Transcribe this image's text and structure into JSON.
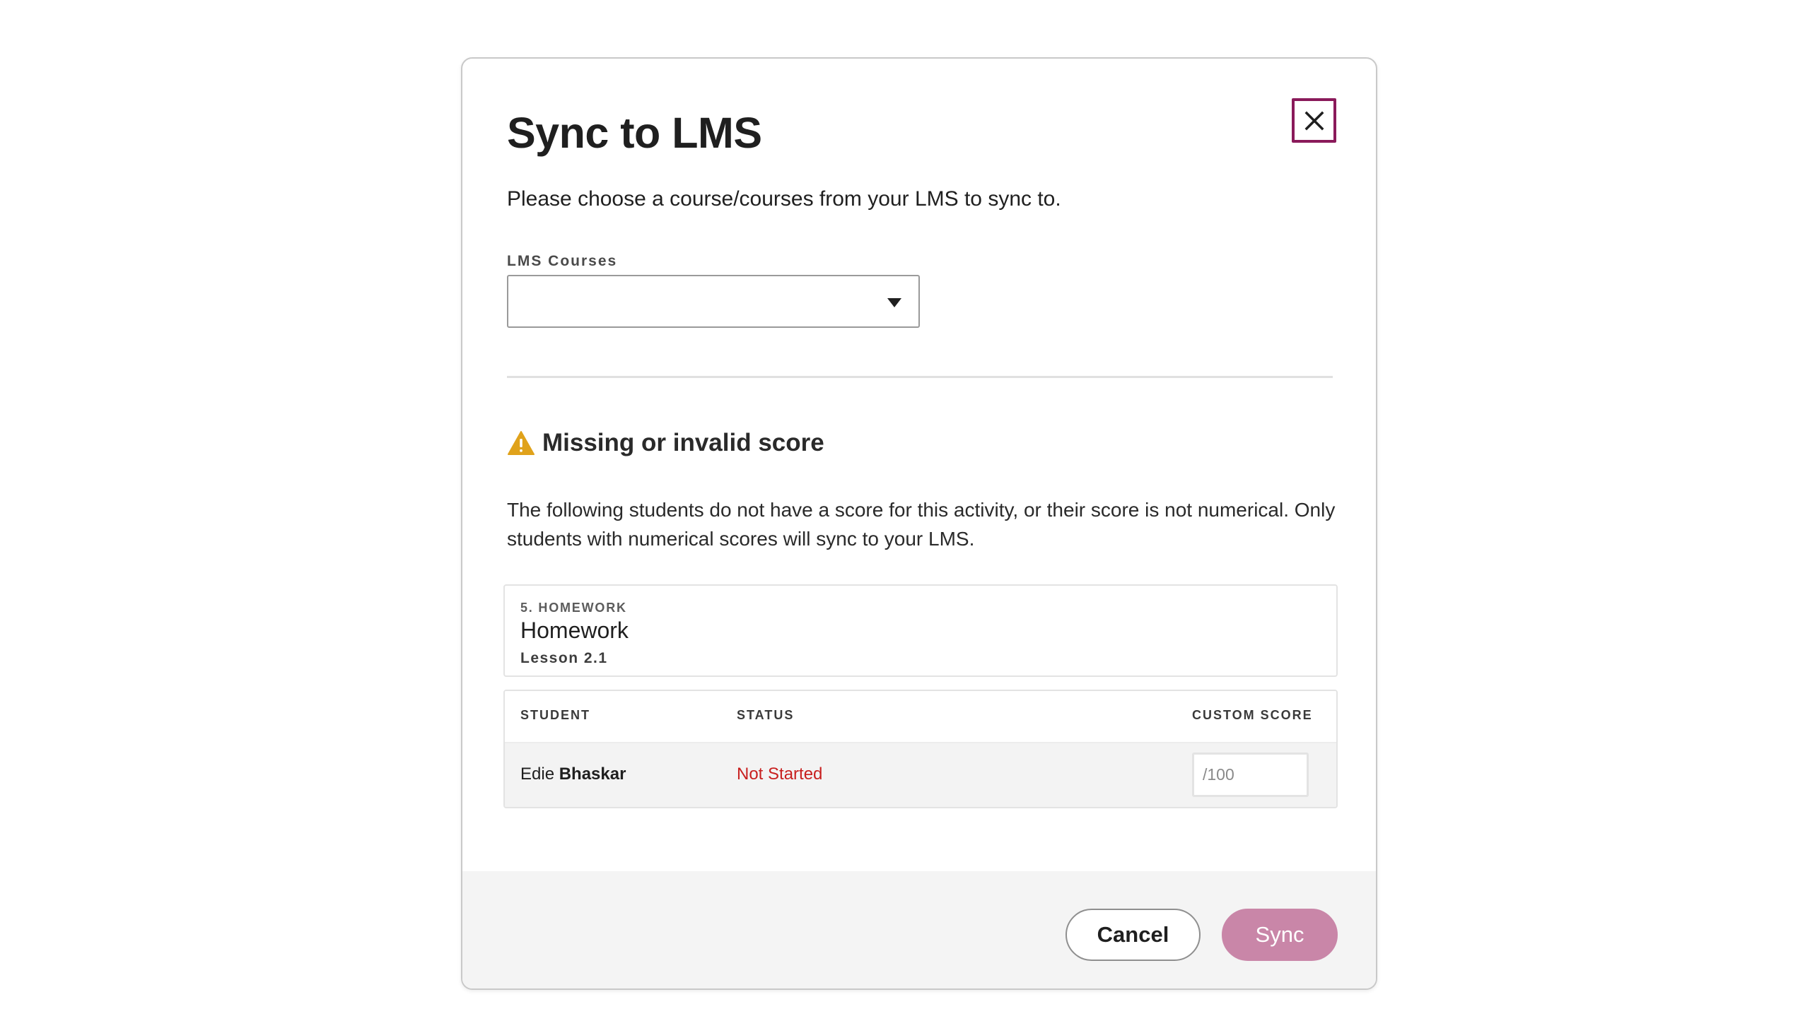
{
  "dialog": {
    "title": "Sync to LMS",
    "subtitle": "Please choose a course/courses from your LMS to sync to.",
    "close_icon": "close-icon"
  },
  "courses_field": {
    "label": "LMS Courses",
    "selected_value": ""
  },
  "warning": {
    "icon": "warning-triangle-icon",
    "icon_color": "#e0a21b",
    "title": "Missing or invalid score",
    "description": "The following students do not have a score for this activity, or their score is not numerical. Only students with numerical scores will sync to your LMS."
  },
  "activity": {
    "kicker": "5. HOMEWORK",
    "name": "Homework",
    "lesson": "Lesson 2.1"
  },
  "table": {
    "columns": [
      "STUDENT",
      "STATUS",
      "CUSTOM SCORE"
    ],
    "rows": [
      {
        "student_first": "Edie",
        "student_last": "Bhaskar",
        "status": "Not Started",
        "custom_score_value": "",
        "custom_score_placeholder": "/100"
      }
    ]
  },
  "footer": {
    "cancel_label": "Cancel",
    "sync_label": "Sync"
  },
  "colors": {
    "close_border": "#8a1a5a",
    "status_not_started": "#c8201f",
    "sync_button": "#c986a8"
  }
}
